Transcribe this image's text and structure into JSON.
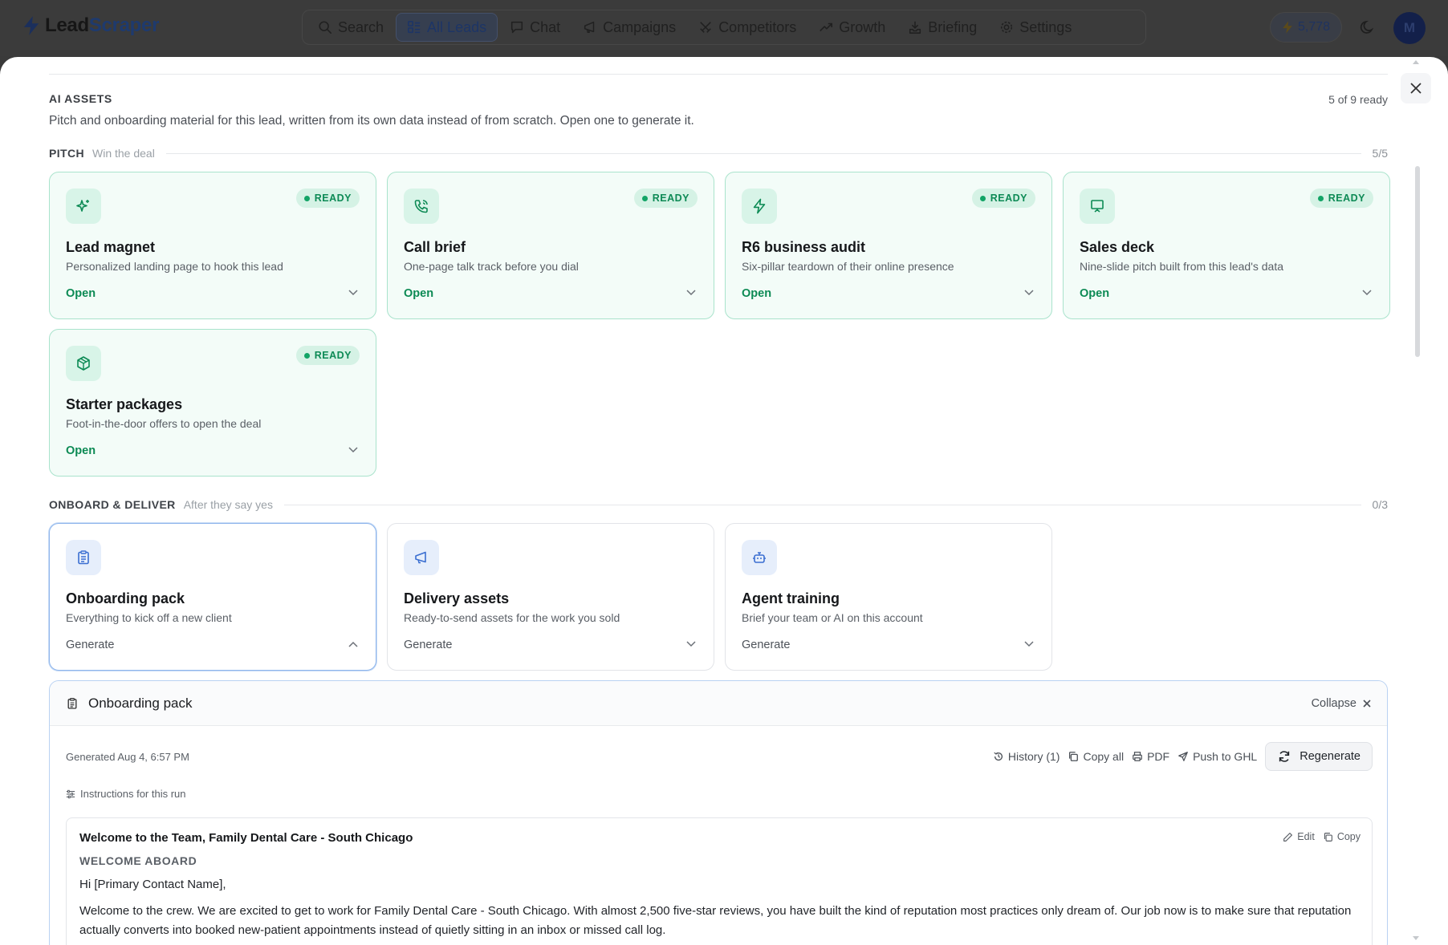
{
  "app": {
    "brand_lead": "Lead",
    "brand_scraper": "Scraper",
    "nav": [
      {
        "label": "Search",
        "icon": "search-icon"
      },
      {
        "label": "All Leads",
        "icon": "grid-icon",
        "active": true
      },
      {
        "label": "Chat",
        "icon": "chat-icon"
      },
      {
        "label": "Campaigns",
        "icon": "megaphone-icon"
      },
      {
        "label": "Competitors",
        "icon": "swords-icon"
      },
      {
        "label": "Growth",
        "icon": "trend-up-icon"
      },
      {
        "label": "Briefing",
        "icon": "briefing-icon"
      },
      {
        "label": "Settings",
        "icon": "gear-icon"
      }
    ],
    "credits": "5,778",
    "avatar_initial": "M"
  },
  "assets": {
    "title": "AI ASSETS",
    "ready_count": "5 of 9 ready",
    "description": "Pitch and onboarding material for this lead, written from its own data instead of from scratch. Open one to generate it.",
    "ready_badge": "READY"
  },
  "pitch": {
    "label": "PITCH",
    "sub": "Win the deal",
    "count": "5/5",
    "cards": [
      {
        "title": "Lead magnet",
        "sub": "Personalized landing page to hook this lead",
        "action": "Open",
        "icon": "sparkles-icon"
      },
      {
        "title": "Call brief",
        "sub": "One-page talk track before you dial",
        "action": "Open",
        "icon": "phone-icon"
      },
      {
        "title": "R6 business audit",
        "sub": "Six-pillar teardown of their online presence",
        "action": "Open",
        "icon": "bolt-icon"
      },
      {
        "title": "Sales deck",
        "sub": "Nine-slide pitch built from this lead's data",
        "action": "Open",
        "icon": "presentation-icon"
      },
      {
        "title": "Starter packages",
        "sub": "Foot-in-the-door offers to open the deal",
        "action": "Open",
        "icon": "package-icon"
      }
    ]
  },
  "onboard": {
    "label": "ONBOARD & DELIVER",
    "sub": "After they say yes",
    "count": "0/3",
    "cards": [
      {
        "title": "Onboarding pack",
        "sub": "Everything to kick off a new client",
        "action": "Generate",
        "icon": "clipboard-icon"
      },
      {
        "title": "Delivery assets",
        "sub": "Ready-to-send assets for the work you sold",
        "action": "Generate",
        "icon": "megaphone-icon"
      },
      {
        "title": "Agent training",
        "sub": "Brief your team or AI on this account",
        "action": "Generate",
        "icon": "robot-icon"
      }
    ]
  },
  "panel": {
    "title": "Onboarding pack",
    "collapse": "Collapse",
    "generated": "Generated Aug 4, 6:57 PM",
    "history": "History (1)",
    "copy_all": "Copy all",
    "pdf": "PDF",
    "push": "Push to GHL",
    "regenerate": "Regenerate",
    "instructions": "Instructions for this run",
    "doc": {
      "title": "Welcome to the Team, Family Dental Care - South Chicago",
      "edit": "Edit",
      "copy": "Copy",
      "kicker": "WELCOME ABOARD",
      "greeting": "Hi [Primary Contact Name],",
      "paragraph": "Welcome to the crew. We are excited to get to work for Family Dental Care - South Chicago. With almost 2,500 five-star reviews, you have built the kind of reputation most practices only dream of. Our job now is to make sure that reputation actually converts into booked new-patient appointments instead of quietly sitting in an inbox or missed call log."
    }
  },
  "colors": {
    "ready_green": "#0c8a54",
    "ready_bg": "#f3fcf8",
    "accent_blue": "#8fb6ec"
  }
}
